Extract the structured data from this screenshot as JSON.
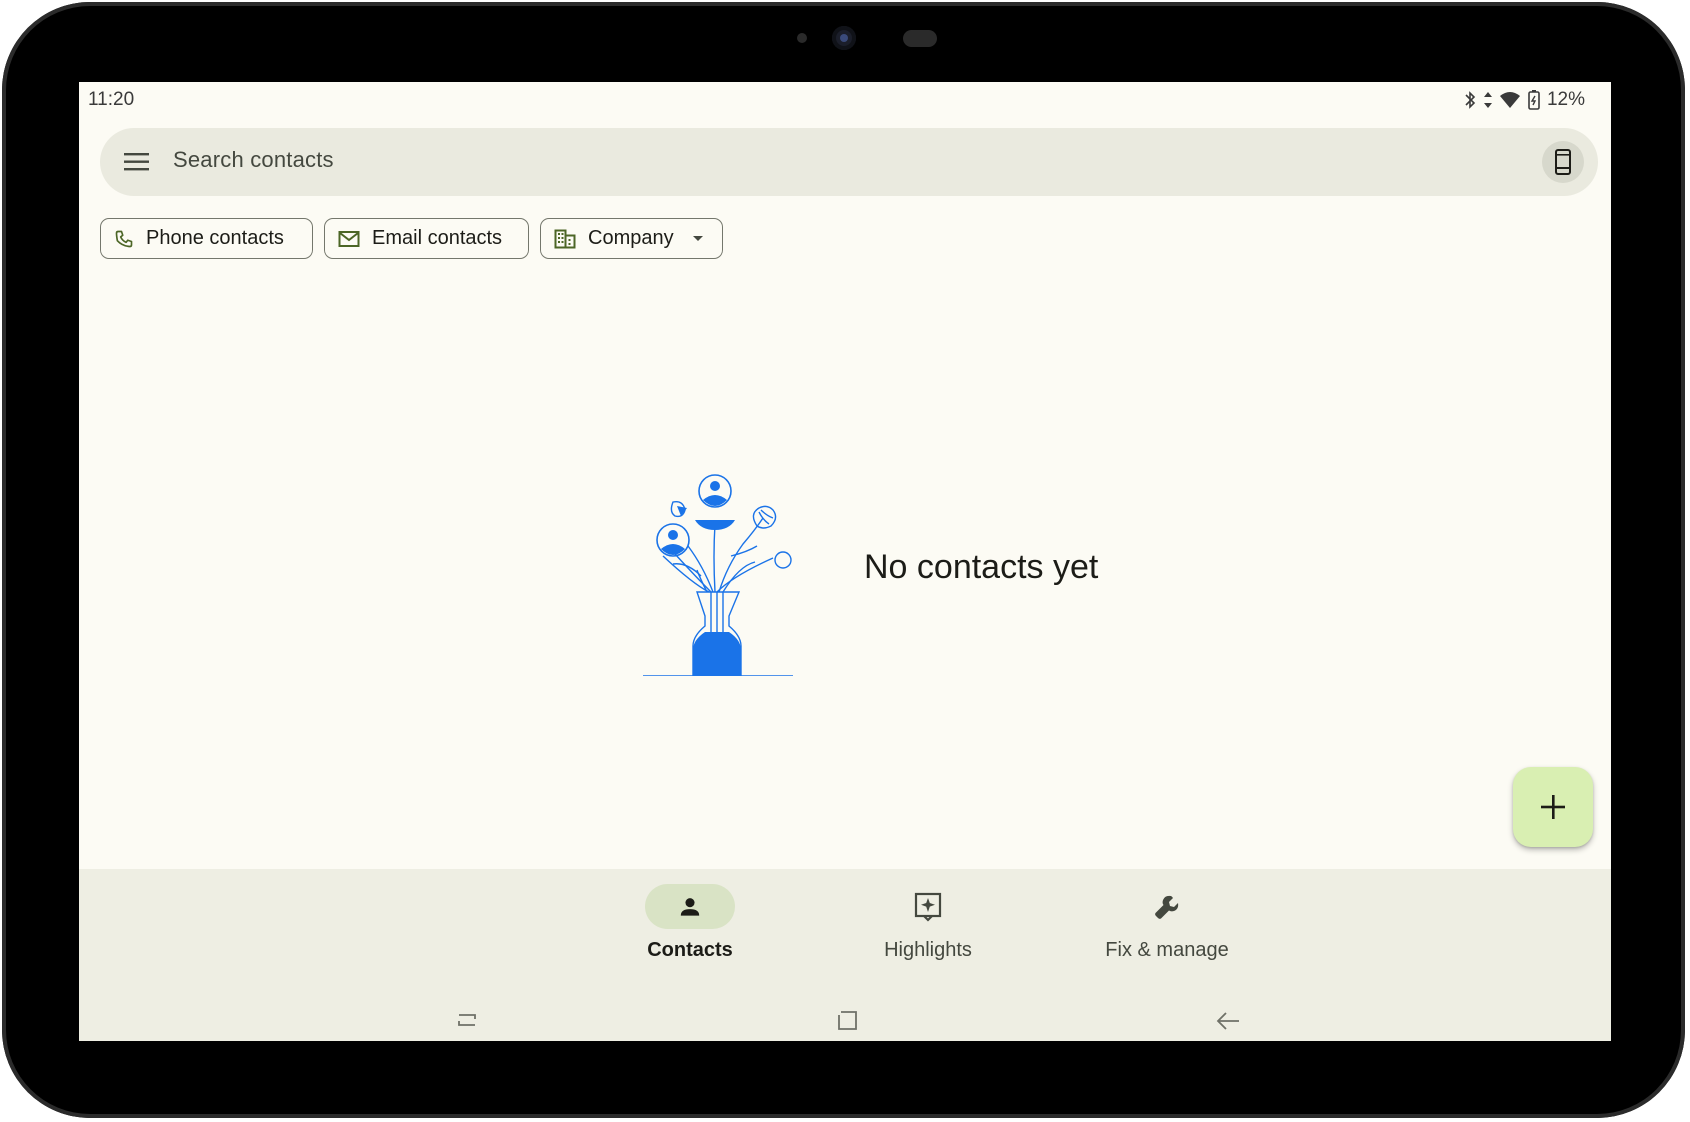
{
  "statusbar": {
    "time": "11:20",
    "battery": "12%",
    "icons": [
      "bluetooth-icon",
      "data-arrows-icon",
      "wifi-icon",
      "battery-icon"
    ]
  },
  "search": {
    "placeholder": "Search contacts"
  },
  "chips": [
    {
      "label": "Phone contacts",
      "icon": "phone-icon"
    },
    {
      "label": "Email contacts",
      "icon": "mail-icon"
    },
    {
      "label": "Company",
      "icon": "building-icon",
      "dropdown": true
    }
  ],
  "empty_state": {
    "message": "No contacts yet"
  },
  "fab": {
    "icon": "plus-icon"
  },
  "bottom_nav": {
    "items": [
      {
        "label": "Contacts",
        "icon": "person-icon",
        "active": true
      },
      {
        "label": "Highlights",
        "icon": "highlights-icon",
        "active": false
      },
      {
        "label": "Fix & manage",
        "icon": "wrench-icon",
        "active": false
      }
    ]
  },
  "colors": {
    "background": "#fcfbf4",
    "surface": "#eaeadf",
    "fab": "#d9efb2",
    "active_pill": "#d9e3c5",
    "illustration": "#1a73e8",
    "icon_accent": "#4c6626"
  }
}
